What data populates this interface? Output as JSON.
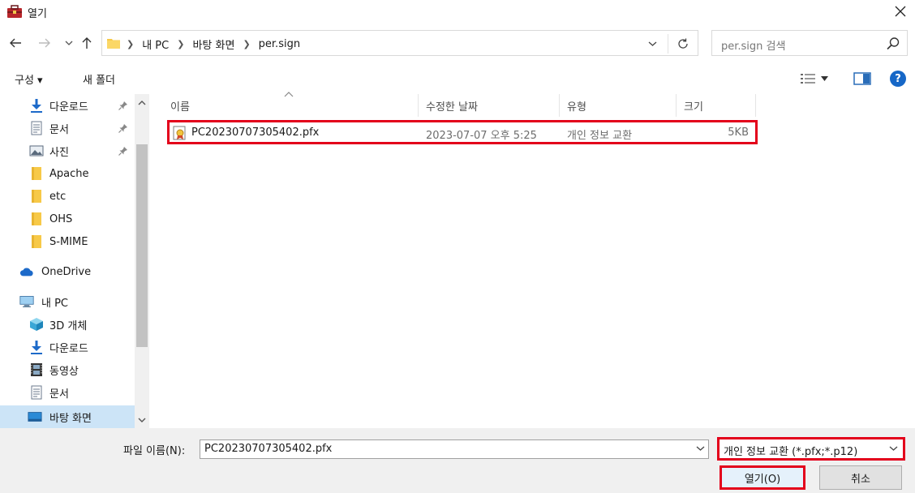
{
  "window": {
    "title": "열기",
    "icon": "certificate-toolbox-icon"
  },
  "nav": {
    "path": [
      "내 PC",
      "바탕 화면",
      "per.sign"
    ],
    "search_placeholder": "per.sign 검색"
  },
  "toolbar": {
    "organize_label": "구성 ▾",
    "new_folder_label": "새 폴더"
  },
  "sidebar": {
    "items": [
      {
        "label": "다운로드",
        "icon": "download-arrow-icon",
        "pinned": true
      },
      {
        "label": "문서",
        "icon": "document-icon",
        "pinned": true
      },
      {
        "label": "사진",
        "icon": "picture-icon",
        "pinned": true
      },
      {
        "label": "Apache",
        "icon": "folder-icon"
      },
      {
        "label": "etc",
        "icon": "folder-icon"
      },
      {
        "label": "OHS",
        "icon": "folder-icon"
      },
      {
        "label": "S-MIME",
        "icon": "folder-icon"
      },
      {
        "label": "OneDrive",
        "icon": "cloud-icon"
      },
      {
        "label": "내 PC",
        "icon": "computer-icon"
      },
      {
        "label": "3D 개체",
        "icon": "cube-icon"
      },
      {
        "label": "다운로드",
        "icon": "download-arrow-icon"
      },
      {
        "label": "동영상",
        "icon": "film-icon"
      },
      {
        "label": "문서",
        "icon": "document-icon"
      },
      {
        "label": "바탕 화면",
        "icon": "desktop-icon",
        "selected": true
      }
    ]
  },
  "columns": {
    "name": "이름",
    "modified": "수정한 날짜",
    "type": "유형",
    "size": "크기"
  },
  "files": [
    {
      "name": "PC20230707305402.pfx",
      "modified": "2023-07-07 오후 5:25",
      "type": "개인 정보 교환",
      "size": "5KB"
    }
  ],
  "footer": {
    "filename_label": "파일 이름(N):",
    "filename_value": "PC20230707305402.pfx",
    "filetype_value": "개인 정보 교환 (*.pfx;*.p12)",
    "open_label": "열기(O)",
    "cancel_label": "취소"
  },
  "colors": {
    "highlight": "#e3001b",
    "selection": "#cce4f7",
    "accent": "#1667c7",
    "folder": "#f7c948"
  }
}
